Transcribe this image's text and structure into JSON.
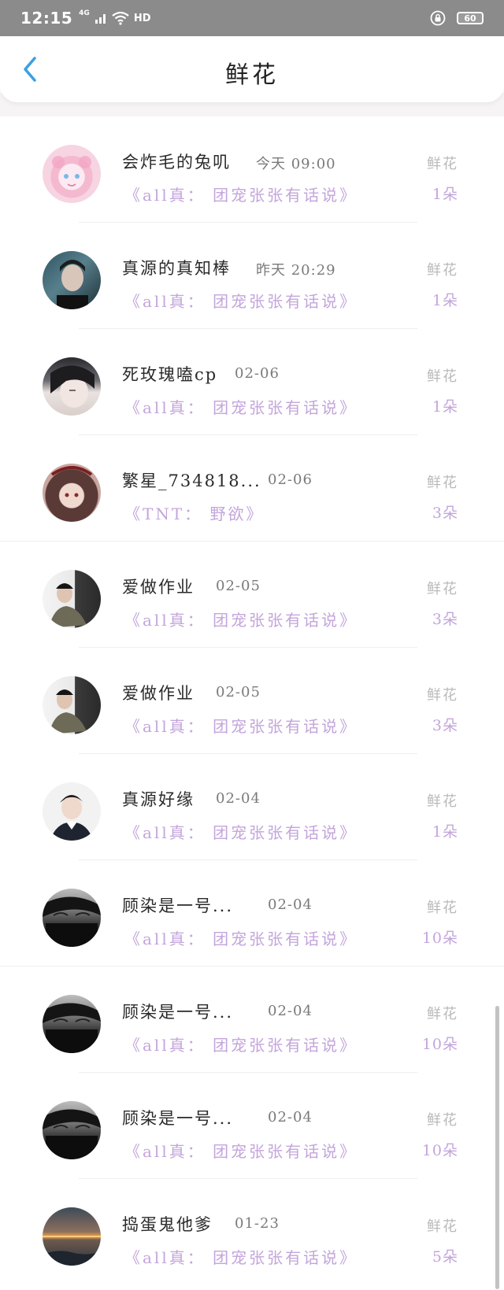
{
  "status": {
    "time": "12:15",
    "net": "4G",
    "hd": "HD",
    "battery": "60"
  },
  "header": {
    "title": "鲜花"
  },
  "icons": {
    "back": "chevron-left-icon",
    "wifi": "wifi-icon",
    "signal": "signal-icon",
    "lock": "lock-icon",
    "battery": "battery-icon"
  },
  "colors": {
    "accent_purple": "#c3a5db",
    "back_arrow": "#3aa0e0",
    "status_bar": "#8b8b8b"
  },
  "records": [
    {
      "name": "会炸毛的兔叽",
      "time": "今天 09:00",
      "subtitle": "《all真： 团宠张张有话说》",
      "gift": "鲜花",
      "count": "1朵"
    },
    {
      "name": "真源的真知棒",
      "time": "昨天 20:29",
      "subtitle": "《all真： 团宠张张有话说》",
      "gift": "鲜花",
      "count": "1朵"
    },
    {
      "name": "死玫瑰嗑cp",
      "time": "02-06",
      "subtitle": "《all真： 团宠张张有话说》",
      "gift": "鲜花",
      "count": "1朵"
    },
    {
      "name": "繁星_734818...",
      "time": "02-06",
      "subtitle": "《TNT： 野欲》",
      "gift": "鲜花",
      "count": "3朵"
    },
    {
      "name": "爱做作业",
      "time": "02-05",
      "subtitle": "《all真： 团宠张张有话说》",
      "gift": "鲜花",
      "count": "3朵"
    },
    {
      "name": "爱做作业",
      "time": "02-05",
      "subtitle": "《all真： 团宠张张有话说》",
      "gift": "鲜花",
      "count": "3朵"
    },
    {
      "name": "真源好缘",
      "time": "02-04",
      "subtitle": "《all真： 团宠张张有话说》",
      "gift": "鲜花",
      "count": "1朵"
    },
    {
      "name": "顾染是一号...",
      "time": "02-04",
      "subtitle": "《all真： 团宠张张有话说》",
      "gift": "鲜花",
      "count": "10朵"
    },
    {
      "name": "顾染是一号...",
      "time": "02-04",
      "subtitle": "《all真： 团宠张张有话说》",
      "gift": "鲜花",
      "count": "10朵"
    },
    {
      "name": "顾染是一号...",
      "time": "02-04",
      "subtitle": "《all真： 团宠张张有话说》",
      "gift": "鲜花",
      "count": "10朵"
    },
    {
      "name": "捣蛋鬼他爹",
      "time": "01-23",
      "subtitle": "《all真： 团宠张张有话说》",
      "gift": "鲜花",
      "count": "5朵"
    }
  ]
}
